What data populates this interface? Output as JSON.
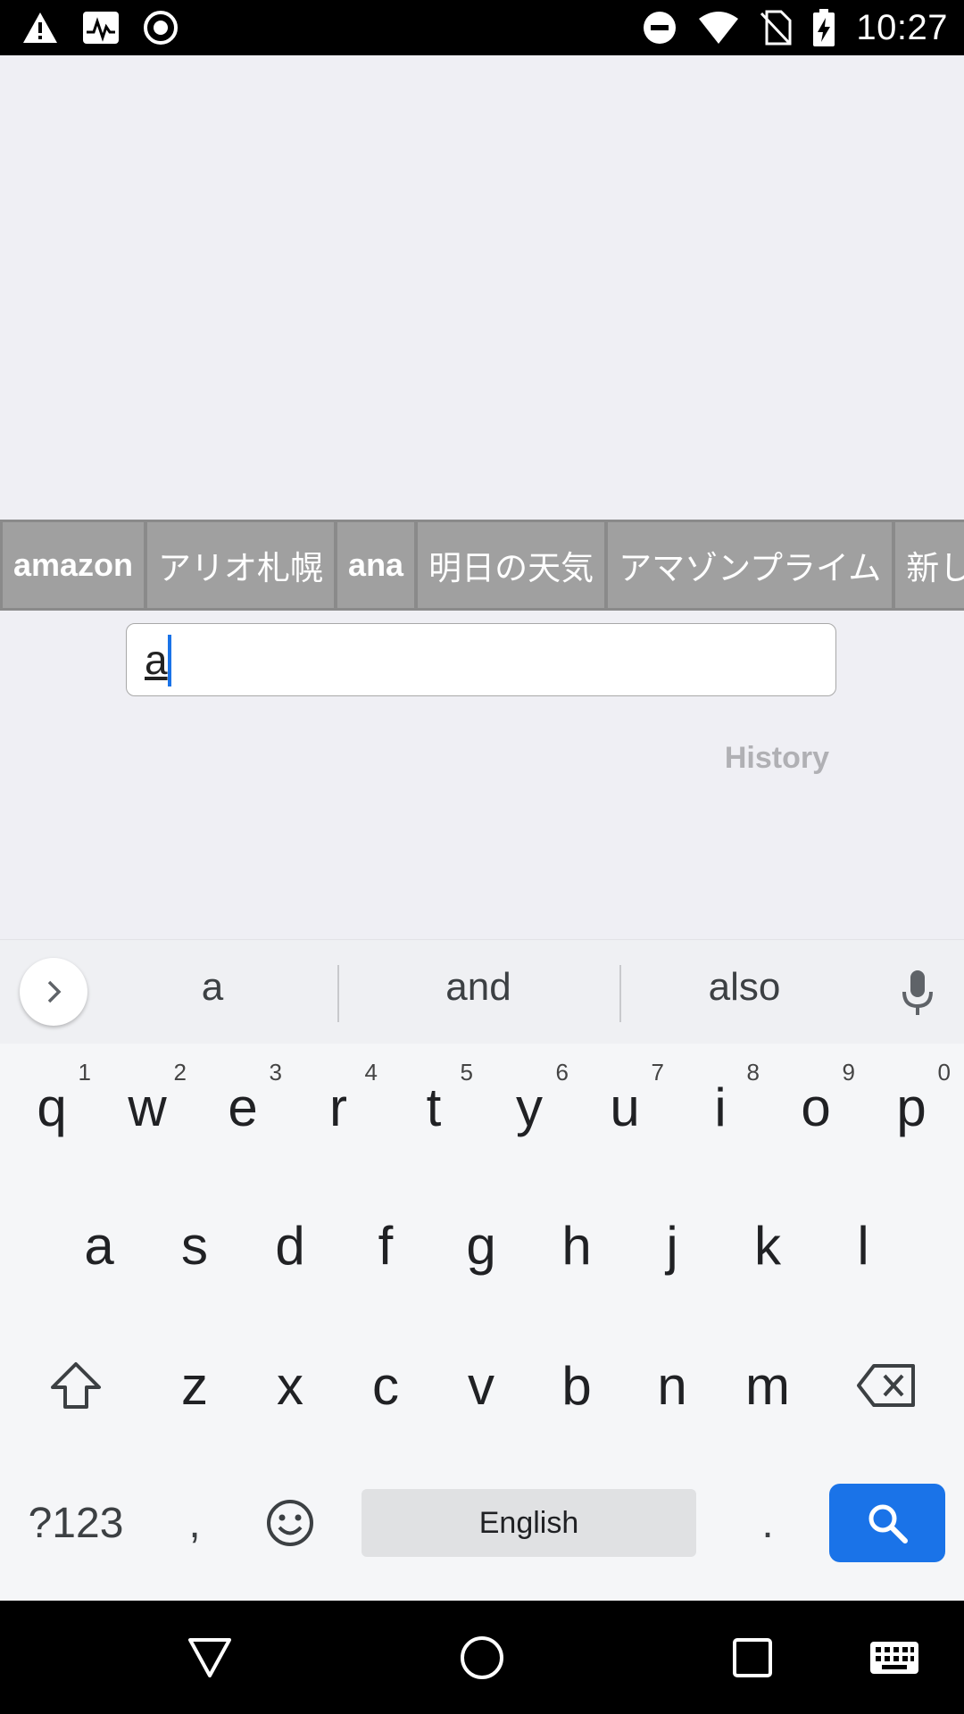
{
  "status_bar": {
    "time": "10:27",
    "left_icons": [
      "warning-icon",
      "activity-monitor-icon",
      "record-icon"
    ],
    "right_icons": [
      "do-not-disturb-icon",
      "wifi-icon",
      "no-sim-icon",
      "battery-charging-icon"
    ]
  },
  "suggestions": [
    "amazon",
    "アリオ札幌",
    "ana",
    "明日の天気",
    "アマゾンプライム",
    "新し"
  ],
  "search": {
    "value": "a"
  },
  "history_label": "History",
  "keyboard": {
    "word_suggestions": [
      "a",
      "and",
      "also"
    ],
    "row1": [
      {
        "key": "q",
        "hint": "1"
      },
      {
        "key": "w",
        "hint": "2"
      },
      {
        "key": "e",
        "hint": "3"
      },
      {
        "key": "r",
        "hint": "4"
      },
      {
        "key": "t",
        "hint": "5"
      },
      {
        "key": "y",
        "hint": "6"
      },
      {
        "key": "u",
        "hint": "7"
      },
      {
        "key": "i",
        "hint": "8"
      },
      {
        "key": "o",
        "hint": "9"
      },
      {
        "key": "p",
        "hint": "0"
      }
    ],
    "row2": [
      "a",
      "s",
      "d",
      "f",
      "g",
      "h",
      "j",
      "k",
      "l"
    ],
    "row3": [
      "z",
      "x",
      "c",
      "v",
      "b",
      "n",
      "m"
    ],
    "symbols_label": "?123",
    "comma": ",",
    "period": ".",
    "space_label": "English"
  },
  "colors": {
    "accent": "#1a73e8",
    "chip_bg": "#a0a0a0",
    "app_bg": "#efeff4"
  }
}
